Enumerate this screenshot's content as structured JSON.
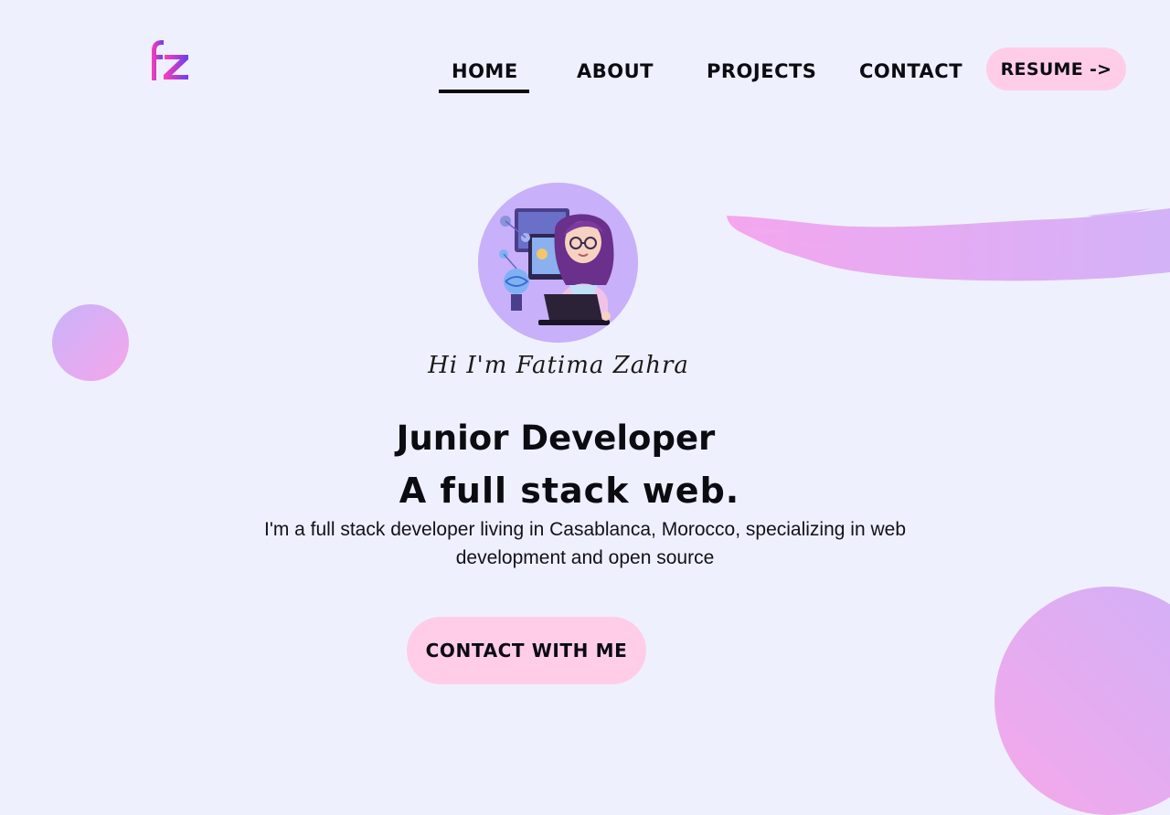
{
  "logo": {
    "text": "fZ",
    "icon": "fz-monogram-logo",
    "colors": [
      "#ff3fb0",
      "#6b3df2"
    ]
  },
  "nav": {
    "items": [
      {
        "label": "HOME",
        "active": true
      },
      {
        "label": "ABOUT",
        "active": false
      },
      {
        "label": "PROJECTS",
        "active": false
      },
      {
        "label": "CONTACT",
        "active": false
      }
    ],
    "resume_label": "RESUME ->"
  },
  "hero": {
    "avatar_icon": "developer-girl-avatar-illustration",
    "greeting": "Hi I'm Fatima Zahra",
    "title": "Junior Developer",
    "subtitle": "A full stack web.",
    "description": "I'm a full stack developer living in Casablanca, Morocco, specializing in web development and open source",
    "cta_label": "CONTACT WITH ME"
  },
  "theme": {
    "background": "#eff0fd",
    "button_bg": "#ffcde7",
    "accent_pink": "#f5a6ea",
    "accent_purple": "#c9b3fb",
    "text": "#0b0b12"
  }
}
